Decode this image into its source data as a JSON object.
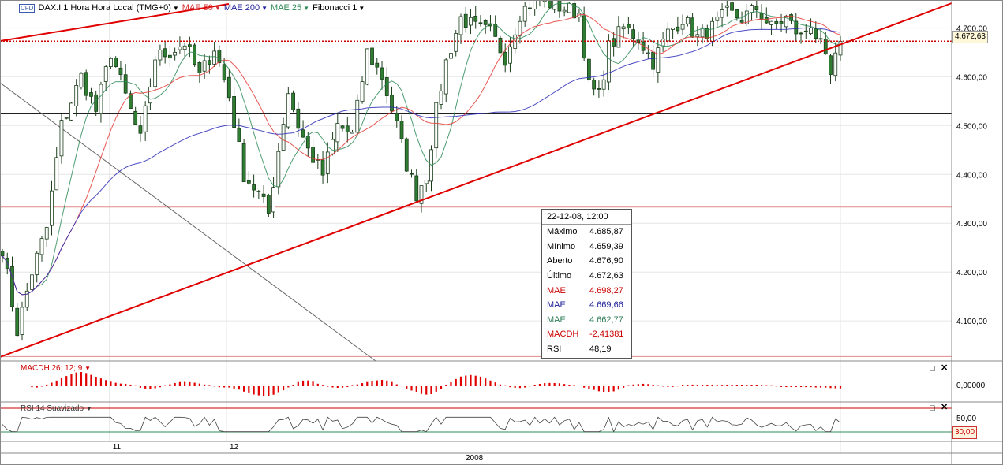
{
  "toolbar": {
    "badge": "CFD",
    "instrument": "DAX.I 1 Hora Hora Local (TMG+0)",
    "mae50": "MAE 50",
    "mae200": "MAE 200",
    "mae25": "MAE 25",
    "fib": "Fibonacci 1"
  },
  "colors": {
    "candle_body": "#2e7d32",
    "mae50": "#e53935",
    "mae200": "#2b2bb8",
    "mae25": "#2e8b57",
    "trendline": "#e00000",
    "grid": "#e6e6e6",
    "price_line": "#cc0000"
  },
  "info": {
    "header": "22-12-08, 12:00",
    "rows": [
      {
        "label": "Máximo",
        "value": "4.685,87",
        "color": "#000000"
      },
      {
        "label": "Mínimo",
        "value": "4.659,39",
        "color": "#000000"
      },
      {
        "label": "Aberto",
        "value": "4.676,90",
        "color": "#000000"
      },
      {
        "label": "Último",
        "value": "4.672,63",
        "color": "#000000"
      },
      {
        "label": "MAE",
        "value": "4.698,27",
        "color": "#cc0000"
      },
      {
        "label": "MAE",
        "value": "4.669,66",
        "color": "#1f1f99"
      },
      {
        "label": "MAE",
        "value": "4.662,77",
        "color": "#2e7d57"
      },
      {
        "label": "MACDH",
        "value": "-2,41381",
        "color": "#cc0000"
      },
      {
        "label": "RSI",
        "value": "48,19",
        "color": "#000000"
      }
    ]
  },
  "current_price_label": "4.672,63",
  "macd": {
    "label": "MACDH 26; 12; 9",
    "axis_label": "0,00000"
  },
  "rsi": {
    "label": "RSI 14 Suavizado",
    "axis_50": "50,00",
    "axis_30": "30,00"
  },
  "xaxis": {
    "ticks": [
      {
        "label": "11",
        "x": 0.115
      },
      {
        "label": "12",
        "x": 0.238
      }
    ],
    "year": "2008"
  },
  "chart_data": {
    "type": "candlestick",
    "title": "DAX.I 1 Hora",
    "y_ticks": [
      4100,
      4200,
      4300,
      4400,
      4500,
      4600,
      4700
    ],
    "y_tick_labels": [
      "4.100,00",
      "4.200,00",
      "4.300,00",
      "4.400,00",
      "4.500,00",
      "4.600,00",
      "4.700,00"
    ],
    "ylim": [
      4018,
      4757
    ],
    "last_price": 4672.63,
    "fib_levels": [
      4524,
      4333,
      4027
    ],
    "keypoints": [
      [
        0,
        4250
      ],
      [
        3,
        4080
      ],
      [
        6,
        4200
      ],
      [
        9,
        4290
      ],
      [
        12,
        4500
      ],
      [
        16,
        4600
      ],
      [
        19,
        4530
      ],
      [
        22,
        4650
      ],
      [
        25,
        4560
      ],
      [
        28,
        4470
      ],
      [
        31,
        4640
      ],
      [
        34,
        4650
      ],
      [
        37,
        4670
      ],
      [
        40,
        4600
      ],
      [
        43,
        4660
      ],
      [
        46,
        4560
      ],
      [
        49,
        4400
      ],
      [
        52,
        4360
      ],
      [
        54,
        4320
      ],
      [
        56,
        4450
      ],
      [
        58,
        4570
      ],
      [
        60,
        4500
      ],
      [
        62,
        4450
      ],
      [
        65,
        4400
      ],
      [
        68,
        4500
      ],
      [
        71,
        4480
      ],
      [
        74,
        4650
      ],
      [
        77,
        4600
      ],
      [
        80,
        4500
      ],
      [
        82,
        4420
      ],
      [
        84,
        4360
      ],
      [
        86,
        4400
      ],
      [
        88,
        4530
      ],
      [
        90,
        4630
      ],
      [
        93,
        4720
      ],
      [
        96,
        4700
      ],
      [
        99,
        4690
      ],
      [
        102,
        4640
      ],
      [
        105,
        4730
      ],
      [
        108,
        4760
      ],
      [
        111,
        4750
      ],
      [
        114,
        4740
      ],
      [
        117,
        4730
      ],
      [
        119,
        4580
      ],
      [
        121,
        4560
      ],
      [
        123,
        4660
      ],
      [
        126,
        4700
      ],
      [
        129,
        4680
      ],
      [
        132,
        4630
      ],
      [
        135,
        4690
      ],
      [
        138,
        4720
      ],
      [
        141,
        4680
      ],
      [
        144,
        4700
      ],
      [
        147,
        4730
      ],
      [
        150,
        4720
      ],
      [
        153,
        4740
      ],
      [
        156,
        4700
      ],
      [
        159,
        4720
      ],
      [
        162,
        4680
      ],
      [
        164,
        4710
      ],
      [
        166,
        4660
      ],
      [
        168,
        4600
      ],
      [
        170,
        4672
      ]
    ]
  }
}
